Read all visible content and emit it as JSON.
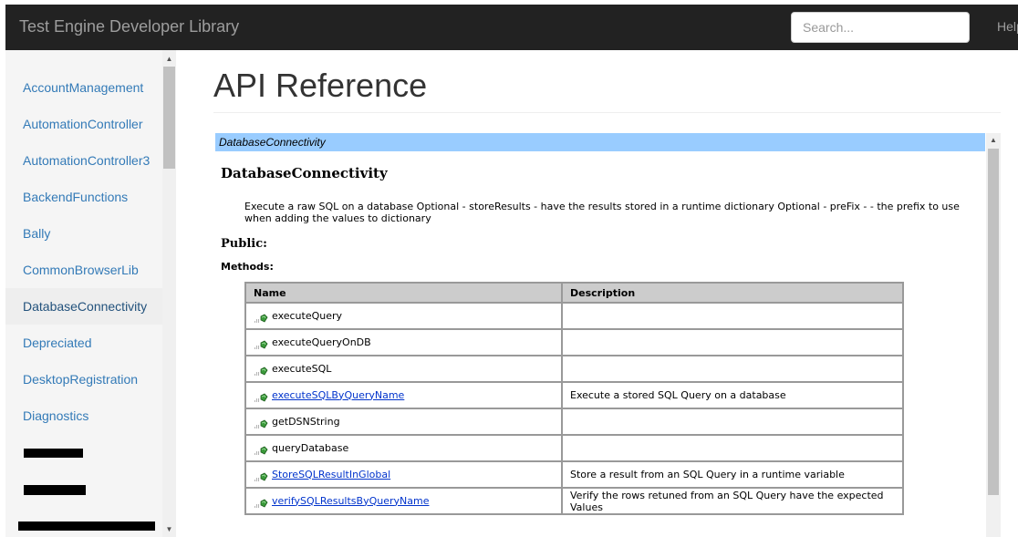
{
  "header": {
    "brand": "Test Engine Developer Library",
    "search_placeholder": "Search...",
    "help_label": "Help"
  },
  "sidebar": {
    "items": [
      {
        "label": "AccountManagement"
      },
      {
        "label": "AutomationController"
      },
      {
        "label": "AutomationController3"
      },
      {
        "label": "BackendFunctions"
      },
      {
        "label": "Bally"
      },
      {
        "label": "CommonBrowserLib"
      },
      {
        "label": "DatabaseConnectivity"
      },
      {
        "label": "Depreciated"
      },
      {
        "label": "DesktopRegistration"
      },
      {
        "label": "Diagnostics"
      }
    ]
  },
  "main": {
    "page_title": "API Reference",
    "frame_header": "DatabaseConnectivity",
    "class_title": "DatabaseConnectivity",
    "description": "Execute a raw SQL on a database Optional - storeResults - have the results stored in a runtime dictionary Optional - preFix - - the prefix to use when adding the values to dictionary",
    "public_label": "Public:",
    "methods_label": "Methods:",
    "table": {
      "headers": {
        "name": "Name",
        "description": "Description"
      },
      "rows": [
        {
          "name": "executeQuery",
          "description": ""
        },
        {
          "name": "executeQueryOnDB",
          "description": ""
        },
        {
          "name": "executeSQL",
          "description": ""
        },
        {
          "name": "executeSQLByQueryName",
          "description": "Execute a stored SQL Query on a database"
        },
        {
          "name": "getDSNString",
          "description": ""
        },
        {
          "name": "queryDatabase",
          "description": ""
        },
        {
          "name": "StoreSQLResultInGlobal",
          "description": "Store a result from an SQL Query in a runtime variable"
        },
        {
          "name": "verifySQLResultsByQueryName",
          "description": "Verify the rows retuned from an SQL Query have the expected Values"
        }
      ]
    }
  },
  "colors": {
    "topbar": "#222222",
    "link": "#337ab7",
    "frame_header_bg": "#99ccff",
    "table_header_bg": "#cccccc"
  }
}
